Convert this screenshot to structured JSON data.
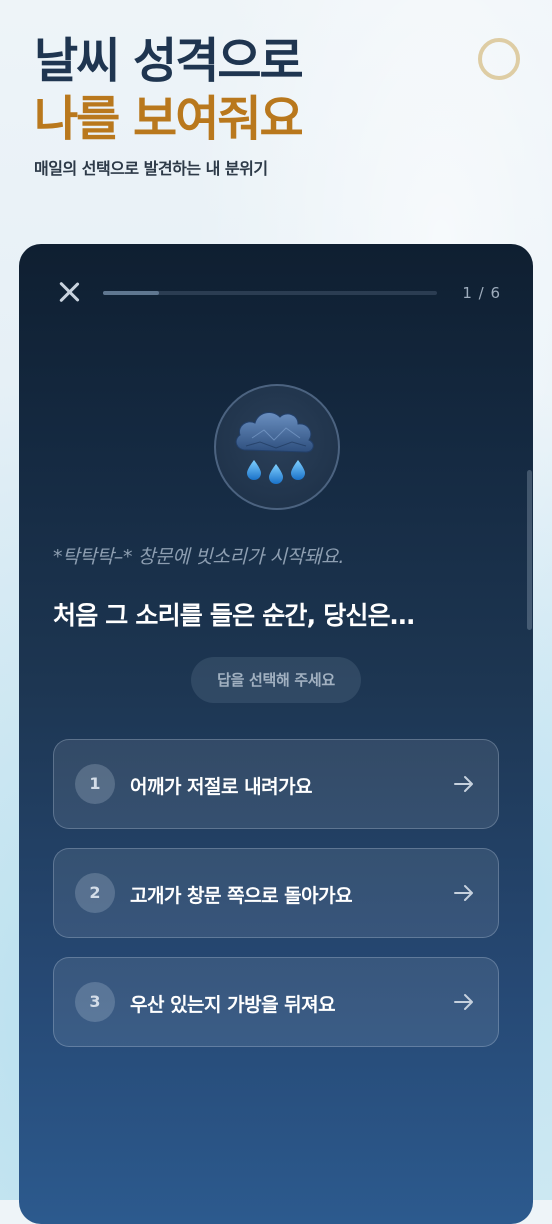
{
  "header": {
    "title_line1": "날씨 성격으로",
    "title_line2": "나를 보여줘요",
    "subtitle": "매일의 선택으로 발견하는 내 분위기"
  },
  "quiz": {
    "progress_text": "1 / 6",
    "progress_fraction": 0.1667,
    "weather_icon": "rain-cloud-icon",
    "narration": "*탁탁탁–* 창문에 빗소리가 시작돼요.",
    "question": "처음 그 소리를 들은 순간, 당신은…",
    "hint": "답을 선택해 주세요",
    "options": [
      {
        "number": "1",
        "label": "어깨가 저절로 내려가요"
      },
      {
        "number": "2",
        "label": "고개가 창문 쪽으로 돌아가요"
      },
      {
        "number": "3",
        "label": "우산 있는지 가방을 뒤져요"
      }
    ]
  },
  "colors": {
    "title_primary": "#1f3550",
    "title_accent": "#b9781d",
    "card_top": "#0f1f31",
    "card_bottom": "#2c5a8e"
  }
}
